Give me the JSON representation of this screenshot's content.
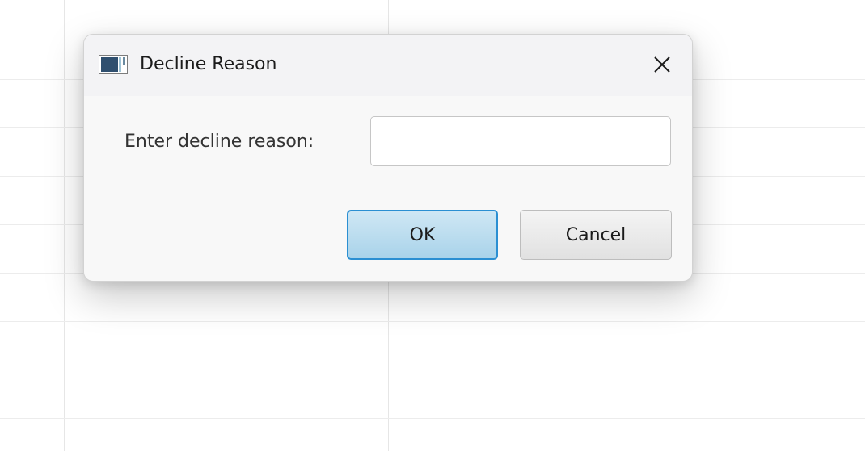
{
  "dialog": {
    "title": "Decline Reason",
    "icon": "app-window-icon",
    "close_icon": "close-icon"
  },
  "form": {
    "label": "Enter decline reason:",
    "input_value": "",
    "input_placeholder": ""
  },
  "buttons": {
    "ok_label": "OK",
    "cancel_label": "Cancel"
  },
  "colors": {
    "ok_accent": "#2b8fd2",
    "ok_fill": "#a9d3ea"
  }
}
